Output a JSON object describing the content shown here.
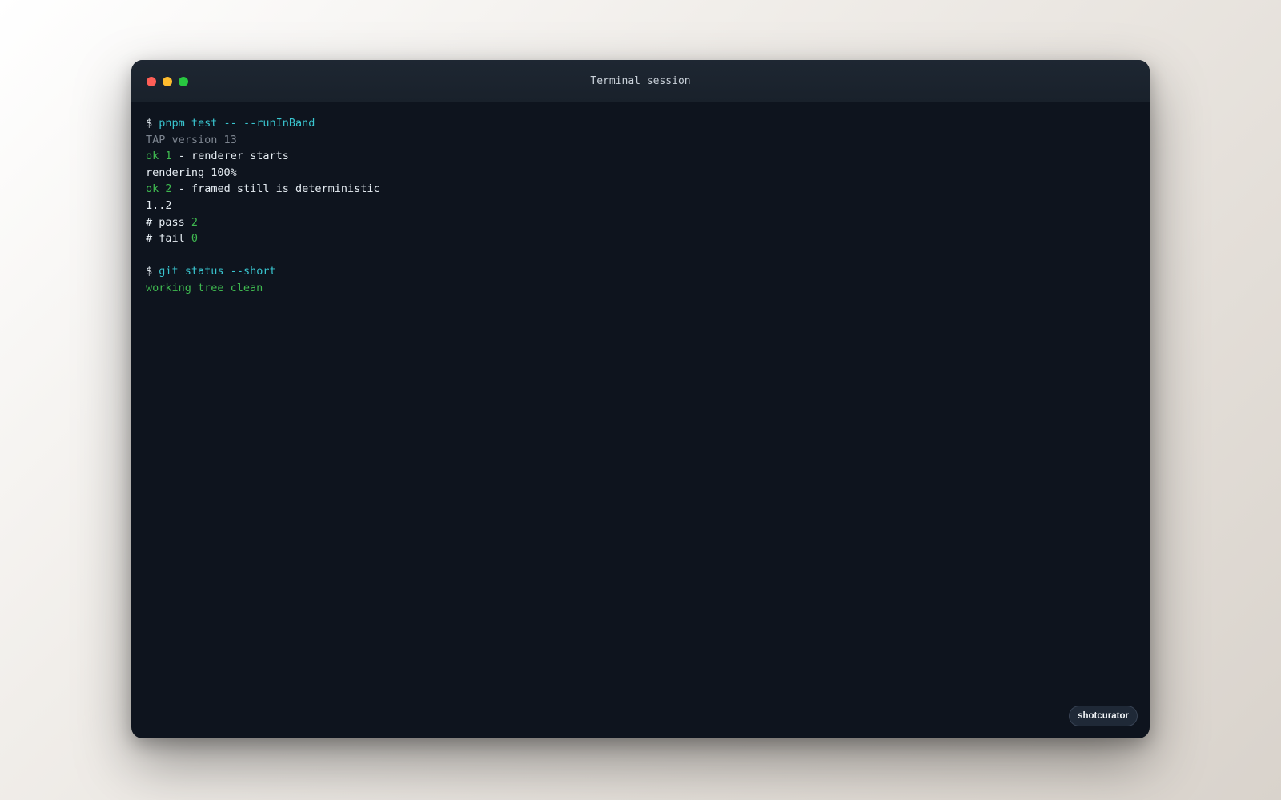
{
  "window": {
    "title": "Terminal session",
    "controls": {
      "close_color": "#ff5f57",
      "minimize_color": "#febc2e",
      "zoom_color": "#28c840"
    }
  },
  "terminal": {
    "lines": [
      {
        "prompt": "$",
        "command": "pnpm test -- --runInBand"
      },
      {
        "text": "TAP version 13"
      },
      {
        "status": "ok",
        "num": "1",
        "desc": "- renderer starts"
      },
      {
        "text": "rendering 100%"
      },
      {
        "status": "ok",
        "num": "2",
        "desc": "- framed still is deterministic"
      },
      {
        "text": "1..2"
      },
      {
        "label": "# pass",
        "value": "2"
      },
      {
        "label": "# fail",
        "value": "0"
      },
      {
        "text": ""
      },
      {
        "prompt": "$",
        "command": "git status --short"
      },
      {
        "text": "working tree clean"
      }
    ]
  },
  "badge": {
    "label": "shotcurator"
  },
  "colors": {
    "command": "#39c5cf",
    "success": "#3fb950",
    "muted": "#7d8590",
    "foreground": "#e6edf3",
    "background": "#0e141e"
  }
}
